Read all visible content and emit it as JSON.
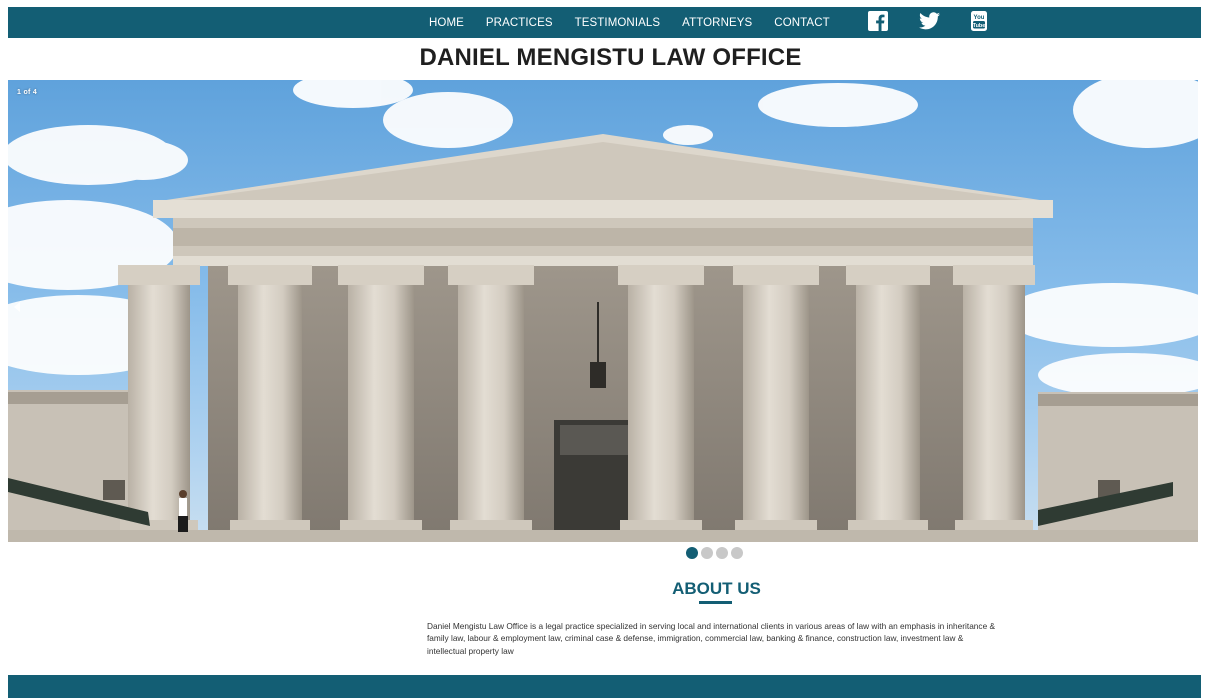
{
  "nav": {
    "items": [
      "HOME",
      "PRACTICES",
      "TESTIMONIALS",
      "ATTORNEYS",
      "CONTACT"
    ],
    "social_icons": [
      "facebook-icon",
      "twitter-icon",
      "youtube-icon"
    ]
  },
  "site_title": "DANIEL MENGISTU LAW OFFICE",
  "slider": {
    "counter": "1 of 4",
    "slide_count": 4,
    "active_index": 0
  },
  "about": {
    "heading": "ABOUT US",
    "body": "Daniel Mengistu Law Office is a legal practice specialized in serving local and international clients in various areas of law with an emphasis in inheritance & family law, labour & employment law, criminal case & defense, immigration, commercial law, banking & finance, construction law, investment law & intellectual property law"
  },
  "colors": {
    "brand": "#135e74",
    "dot_inactive": "#c8c8c8"
  }
}
